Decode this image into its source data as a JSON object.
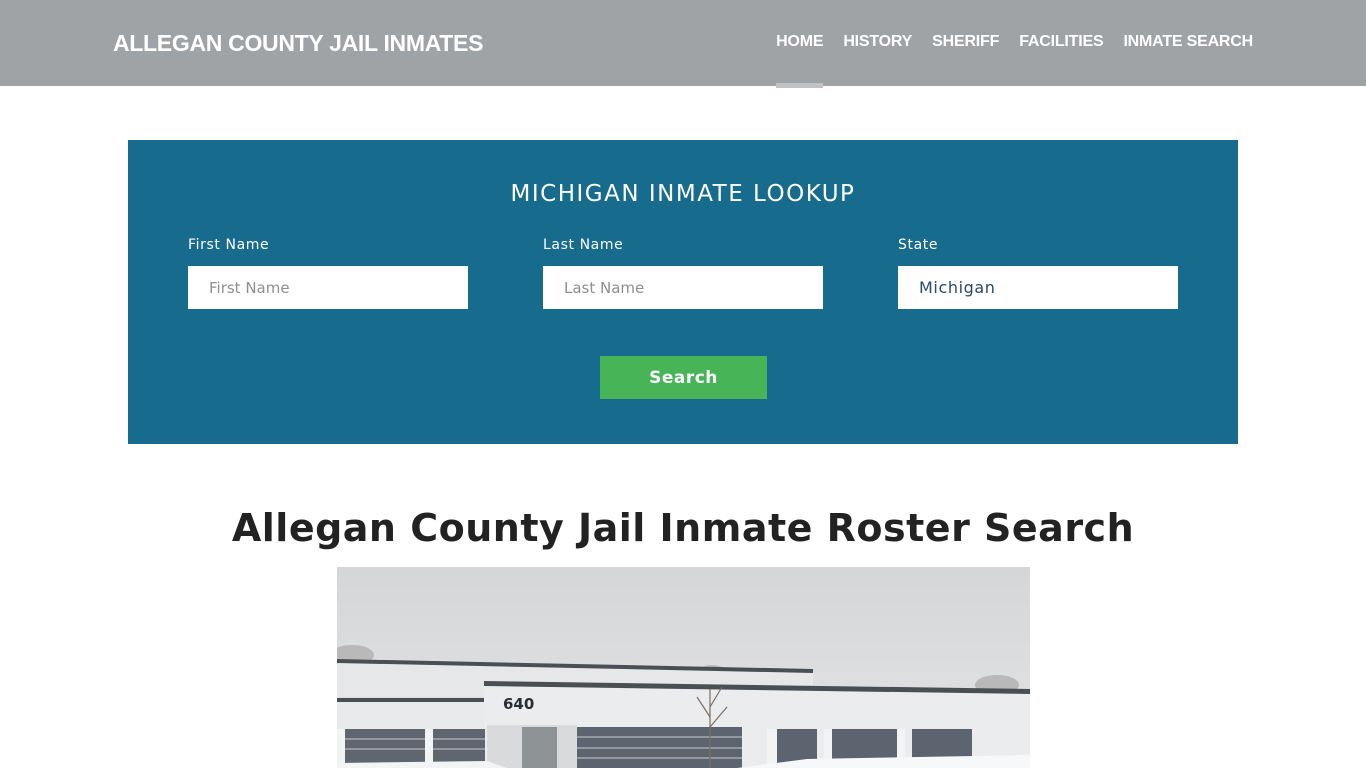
{
  "header": {
    "brand": "ALLEGAN COUNTY JAIL INMATES",
    "nav": [
      {
        "label": "HOME",
        "active": true
      },
      {
        "label": "HISTORY",
        "active": false
      },
      {
        "label": "SHERIFF",
        "active": false
      },
      {
        "label": "FACILITIES",
        "active": false
      },
      {
        "label": "INMATE SEARCH",
        "active": false
      }
    ]
  },
  "lookup": {
    "title": "MICHIGAN INMATE LOOKUP",
    "first_name": {
      "label": "First Name",
      "placeholder": "First Name",
      "value": ""
    },
    "last_name": {
      "label": "Last Name",
      "placeholder": "Last Name",
      "value": ""
    },
    "state": {
      "label": "State",
      "value": "Michigan"
    },
    "search_label": "Search"
  },
  "main": {
    "title": "Allegan County Jail Inmate Roster Search",
    "photo": {
      "alt": "Allegan County Jail building exterior in snow",
      "building_number": "640"
    }
  },
  "colors": {
    "navbar": "#9fa3a6",
    "lookup_bg": "#176b8d",
    "search_button": "#47b458"
  }
}
